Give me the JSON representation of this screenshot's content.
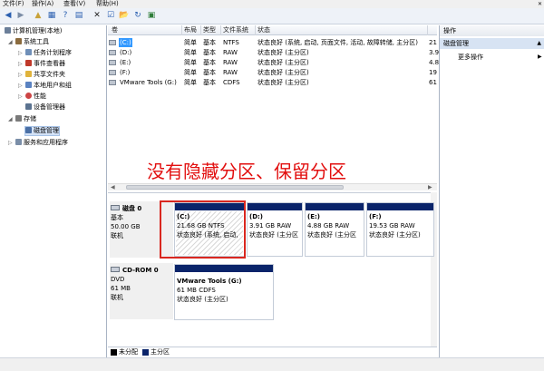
{
  "menu": {
    "file": "文件(F)",
    "action": "操作(A)",
    "view": "查看(V)",
    "help": "帮助(H)",
    "close": "✕"
  },
  "toolbar": {
    "back": "◀",
    "forward": "▶",
    "up": "▲",
    "show_hide": "▦",
    "help": "?",
    "properties": "▤",
    "delete": "✕",
    "check": "☑",
    "open": "📂",
    "refresh": "↻",
    "more": "▣"
  },
  "tree": [
    {
      "label": "计算机管理(本地)",
      "toggle": "",
      "color": "#6b7f99"
    },
    {
      "label": "系统工具",
      "toggle": "◢",
      "color": "#8b6b3e"
    },
    {
      "label": "任务计划程序",
      "toggle": "▷",
      "color": "#6f8fb8"
    },
    {
      "label": "事件查看器",
      "toggle": "▷",
      "color": "#c0392b"
    },
    {
      "label": "共享文件夹",
      "toggle": "▷",
      "color": "#e0b33c"
    },
    {
      "label": "本地用户和组",
      "toggle": "▷",
      "color": "#5a82c1"
    },
    {
      "label": "性能",
      "toggle": "▷",
      "color": "#c44"
    },
    {
      "label": "设备管理器",
      "toggle": "",
      "color": "#5b7390"
    },
    {
      "label": "存储",
      "toggle": "◢",
      "color": "#7a7a7a"
    },
    {
      "label": "磁盘管理",
      "toggle": "",
      "color": "#4a6fa5"
    },
    {
      "label": "服务和应用程序",
      "toggle": "▷",
      "color": "#7a8ea8"
    }
  ],
  "volume_table": {
    "columns": [
      "卷",
      "布局",
      "类型",
      "文件系统",
      "状态"
    ],
    "rows": [
      {
        "volume": "(C:)",
        "layout": "简单",
        "type": "基本",
        "fs": "NTFS",
        "status": "状态良好 (系统, 启动, 页面文件, 活动, 故障转储, 主分区)",
        "cap": "21"
      },
      {
        "volume": "(D:)",
        "layout": "简单",
        "type": "基本",
        "fs": "RAW",
        "status": "状态良好 (主分区)",
        "cap": "3.9"
      },
      {
        "volume": "(E:)",
        "layout": "简单",
        "type": "基本",
        "fs": "RAW",
        "status": "状态良好 (主分区)",
        "cap": "4.8"
      },
      {
        "volume": "(F:)",
        "layout": "简单",
        "type": "基本",
        "fs": "RAW",
        "status": "状态良好 (主分区)",
        "cap": "19"
      },
      {
        "volume": "VMware Tools (G:)",
        "layout": "简单",
        "type": "基本",
        "fs": "CDFS",
        "status": "状态良好 (主分区)",
        "cap": "61"
      }
    ]
  },
  "annotation": "没有隐藏分区、保留分区",
  "disks": [
    {
      "name": "磁盘 0",
      "kind": "基本",
      "size": "50.00 GB",
      "state": "联机"
    },
    {
      "name": "CD-ROM 0",
      "kind": "DVD",
      "size": "61 MB",
      "state": "联机"
    }
  ],
  "partitions": [
    {
      "name": "(C:)",
      "info": "21.68 GB NTFS",
      "status": "状态良好 (系统, 启动,"
    },
    {
      "name": "(D:)",
      "info": "3.91 GB RAW",
      "status": "状态良好 (主分区"
    },
    {
      "name": "(E:)",
      "info": "4.88 GB RAW",
      "status": "状态良好 (主分区"
    },
    {
      "name": "(F:)",
      "info": "19.53 GB RAW",
      "status": "状态良好 (主分区)"
    },
    {
      "name": "VMware Tools (G:)",
      "info": "61 MB CDFS",
      "status": "状态良好 (主分区)"
    }
  ],
  "legend": {
    "unallocated": "未分配",
    "primary": "主分区",
    "unallocated_color": "#000000",
    "primary_color": "#0a246a"
  },
  "actions": {
    "title": "操作",
    "section": "磁盘管理",
    "more": "更多操作"
  }
}
